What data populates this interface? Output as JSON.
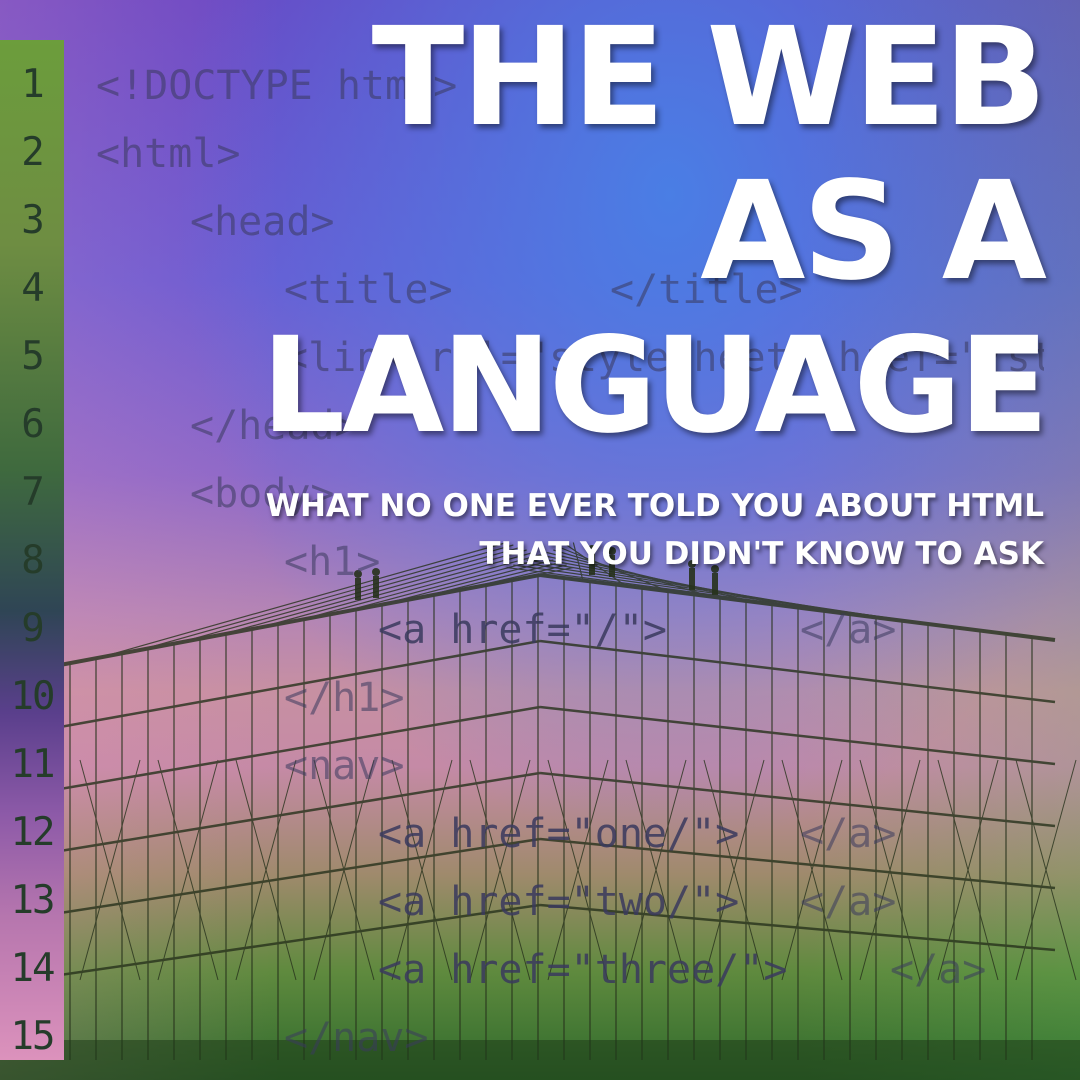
{
  "cover": {
    "title_lines": [
      "THE WEB",
      "AS A",
      "LANGUAGE"
    ],
    "subtitle_lines": [
      "WHAT NO ONE EVER TOLD YOU ABOUT HTML",
      "THAT YOU DIDN'T KNOW TO ASK"
    ]
  },
  "editor": {
    "line_numbers": [
      "1",
      "2",
      "3",
      "4",
      "5",
      "6",
      "7",
      "8",
      "9",
      "10",
      "11",
      "12",
      "13",
      "14",
      "15"
    ],
    "code_fragments": [
      "<!DOCTYPE html>",
      "<html>",
      "<head>",
      "<title>",
      "</title>",
      "<link rel=\"stylesheet\" href=\"/style",
      "</head>",
      "<body>",
      "<h1>",
      "<a href=\"/\">",
      "</a>",
      "</h1>",
      "<nav>",
      "<a href=\"one/\">",
      "</a>",
      "<a href=\"two/\">",
      "</a>",
      "<a href=\"three/\">",
      "</a>",
      "</nav>"
    ]
  },
  "colors": {
    "title_text": "#ffffff",
    "background_top": "#6a48c4",
    "background_bottom": "#2f6a2c",
    "code_text": "#3a3a5e"
  },
  "icons": {
    "background_photo": "scaffolding-silhouette"
  }
}
